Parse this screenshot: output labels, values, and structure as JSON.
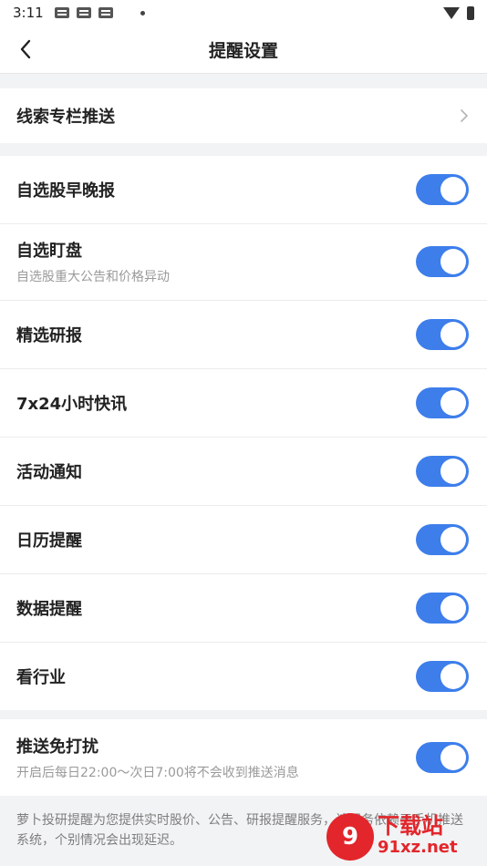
{
  "status": {
    "time": "3:11"
  },
  "header": {
    "title": "提醒设置"
  },
  "section1": {
    "label": "线索专栏推送"
  },
  "settings": [
    {
      "label": "自选股早晚报",
      "sub": "",
      "on": true
    },
    {
      "label": "自选盯盘",
      "sub": "自选股重大公告和价格异动",
      "on": true
    },
    {
      "label": "精选研报",
      "sub": "",
      "on": true
    },
    {
      "label": "7x24小时快讯",
      "sub": "",
      "on": true
    },
    {
      "label": "活动通知",
      "sub": "",
      "on": true
    },
    {
      "label": "日历提醒",
      "sub": "",
      "on": true
    },
    {
      "label": "数据提醒",
      "sub": "",
      "on": true
    },
    {
      "label": "看行业",
      "sub": "",
      "on": true
    }
  ],
  "dnd": {
    "label": "推送免打扰",
    "sub": "开启后每日22:00～次日7:00将不会收到推送消息",
    "on": true
  },
  "footer": {
    "note": "萝卜投研提醒为您提供实时股价、公告、研报提醒服务，该服务依赖于手机推送系统，个别情况会出现延迟。"
  },
  "watermark": {
    "logo": "9",
    "top": "下载站",
    "bottom": "91xz.net"
  },
  "colors": {
    "accent": "#3d7eeb",
    "background": "#f2f3f5"
  }
}
